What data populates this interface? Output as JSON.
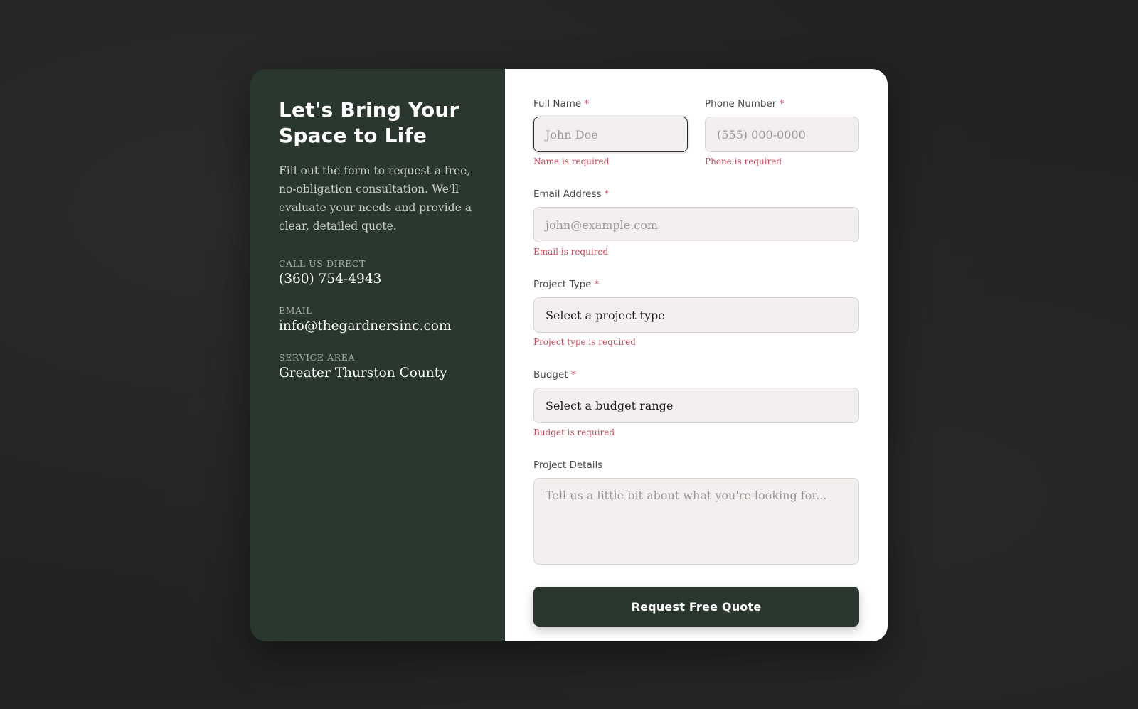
{
  "colors": {
    "panel_green": "#29372f",
    "error_red": "#c64a5b",
    "input_bg": "#f3efee",
    "page_bg": "#222222"
  },
  "left_panel": {
    "heading": "Let's Bring Your Space to Life",
    "intro": "Fill out the form to request a free, no-obligation consultation. We'll evaluate your needs and provide a clear, detailed quote.",
    "contacts": [
      {
        "label": "CALL US DIRECT",
        "value": "(360) 754-4943"
      },
      {
        "label": "EMAIL",
        "value": "info@thegardnersinc.com"
      },
      {
        "label": "SERVICE AREA",
        "value": "Greater Thurston County"
      }
    ]
  },
  "form": {
    "required_marker": "*",
    "full_name": {
      "label": "Full Name",
      "placeholder": "John Doe",
      "error": "Name is required"
    },
    "phone": {
      "label": "Phone Number",
      "placeholder": "(555) 000-0000",
      "error": "Phone is required"
    },
    "email": {
      "label": "Email Address",
      "placeholder": "john@example.com",
      "error": "Email is required"
    },
    "project_type": {
      "label": "Project Type",
      "selected": "Select a project type",
      "error": "Project type is required"
    },
    "budget": {
      "label": "Budget",
      "selected": "Select a budget range",
      "error": "Budget is required"
    },
    "details": {
      "label": "Project Details",
      "placeholder": "Tell us a little bit about what you're looking for..."
    },
    "submit_label": "Request Free Quote"
  }
}
